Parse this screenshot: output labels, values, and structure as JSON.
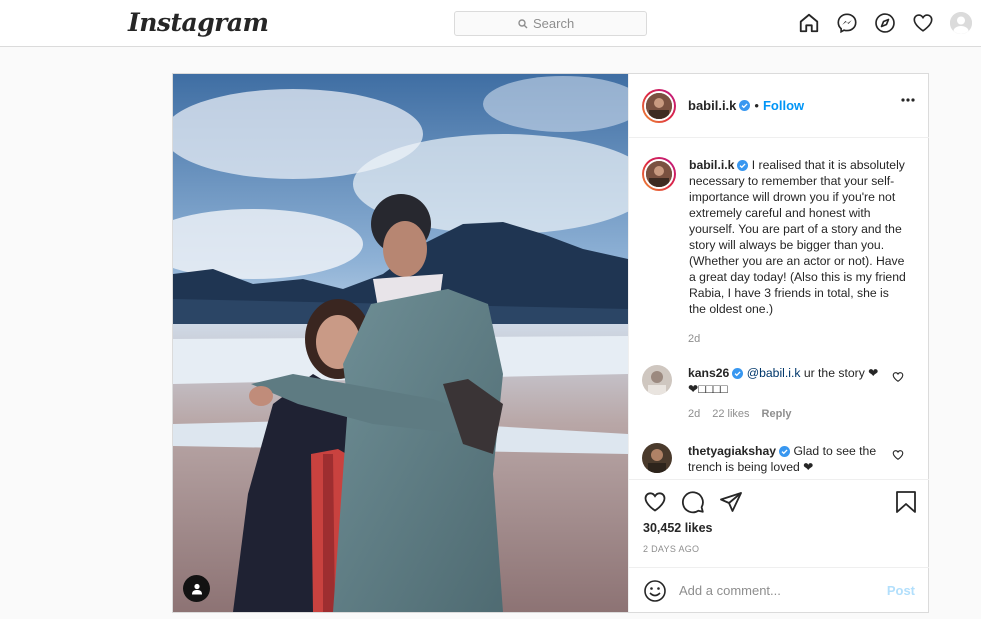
{
  "nav": {
    "logo": "Instagram",
    "search_placeholder": "Search",
    "icons": [
      "home-icon",
      "messenger-icon",
      "explore-icon",
      "heart-icon",
      "profile-avatar"
    ]
  },
  "post": {
    "username": "babil.i.k",
    "follow_label": "Follow",
    "separator": "•",
    "caption_username": "babil.i.k",
    "caption": "I realised that it is absolutely necessary to remember that your self-importance will drown you if you're not extremely careful and honest with yourself. You are part of a story and the story will always be bigger than you. (Whether you are an actor or not). Have a great day today! (Also this is my friend Rabia, I have 3 friends in total, she is the oldest one.)",
    "caption_time": "2d",
    "comments": [
      {
        "username": "kans26",
        "mention": "@babil.i.k",
        "text": " ur the story ❤❤□□□□",
        "time": "2d",
        "likes": "22 likes",
        "reply": "Reply"
      },
      {
        "username": "thetyagiakshay",
        "text": "Glad to see the trench is being loved ❤"
      }
    ],
    "likes_count": "30,452 likes",
    "posted_ago": "2 DAYS AGO",
    "comment_placeholder": "Add a comment...",
    "post_label": "Post"
  },
  "colors": {
    "accent": "#0095f6",
    "border": "#dbdbdb",
    "muted": "#8e8e8e",
    "verified": "#3897f0"
  }
}
